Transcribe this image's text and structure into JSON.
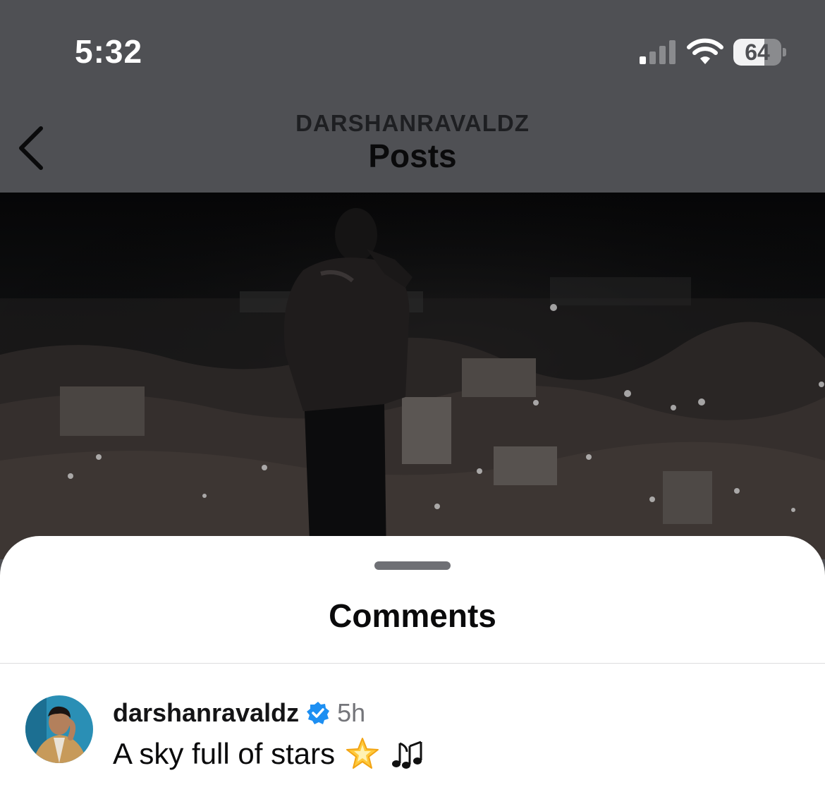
{
  "status_bar": {
    "time": "5:32",
    "signal_icon": "cellular-signal-icon",
    "wifi_icon": "wifi-icon",
    "battery_level": "64"
  },
  "header": {
    "back_icon": "chevron-left-icon",
    "username": "DARSHANRAVALDZ",
    "title": "Posts"
  },
  "post": {
    "image": "concert-stage-photo"
  },
  "comments": {
    "title": "Comments",
    "items": [
      {
        "username": "darshanravaldz",
        "verified": true,
        "time": "5h",
        "text": "A sky full of stars",
        "emojis": [
          "glowing-star-emoji",
          "musical-notes-emoji"
        ]
      }
    ]
  },
  "colors": {
    "header_dim": "#4f5054",
    "sheet_bg": "#ffffff",
    "verified_blue": "#1d8ff2",
    "muted_text": "#74757a"
  }
}
